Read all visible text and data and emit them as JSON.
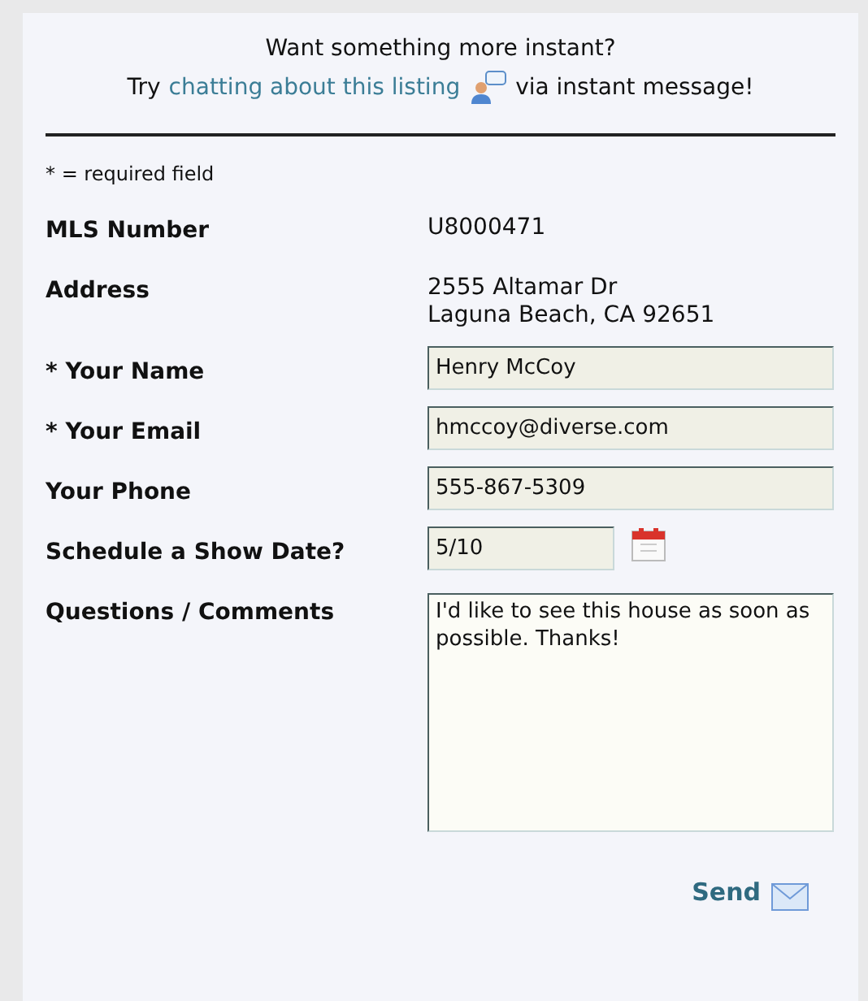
{
  "intro": {
    "heading": "Want something more instant?",
    "before_link": "Try",
    "link": "chatting about this listing",
    "after_link": "via instant message!"
  },
  "required_note": "* = required field",
  "rows": [
    {
      "kind": "info",
      "label": "MLS Number",
      "lines": [
        "U8000471"
      ]
    },
    {
      "kind": "info",
      "label": "Address",
      "lines": [
        "2555 Altamar Dr",
        "Laguna Beach, CA 92651"
      ]
    },
    {
      "kind": "field",
      "label": "* Your Name",
      "value": "Henry McCoy"
    },
    {
      "kind": "field",
      "label": "* Your Email",
      "value": "hmccoy@diverse.com"
    },
    {
      "kind": "field",
      "label": "Your Phone",
      "value": "555-867-5309"
    },
    {
      "kind": "date",
      "label": "Schedule a Show Date?",
      "value": "5/10"
    },
    {
      "kind": "textarea",
      "label": "Questions / Comments",
      "value": "I'd like to see this house as soon as possible. Thanks!"
    }
  ],
  "send_button": "Send"
}
